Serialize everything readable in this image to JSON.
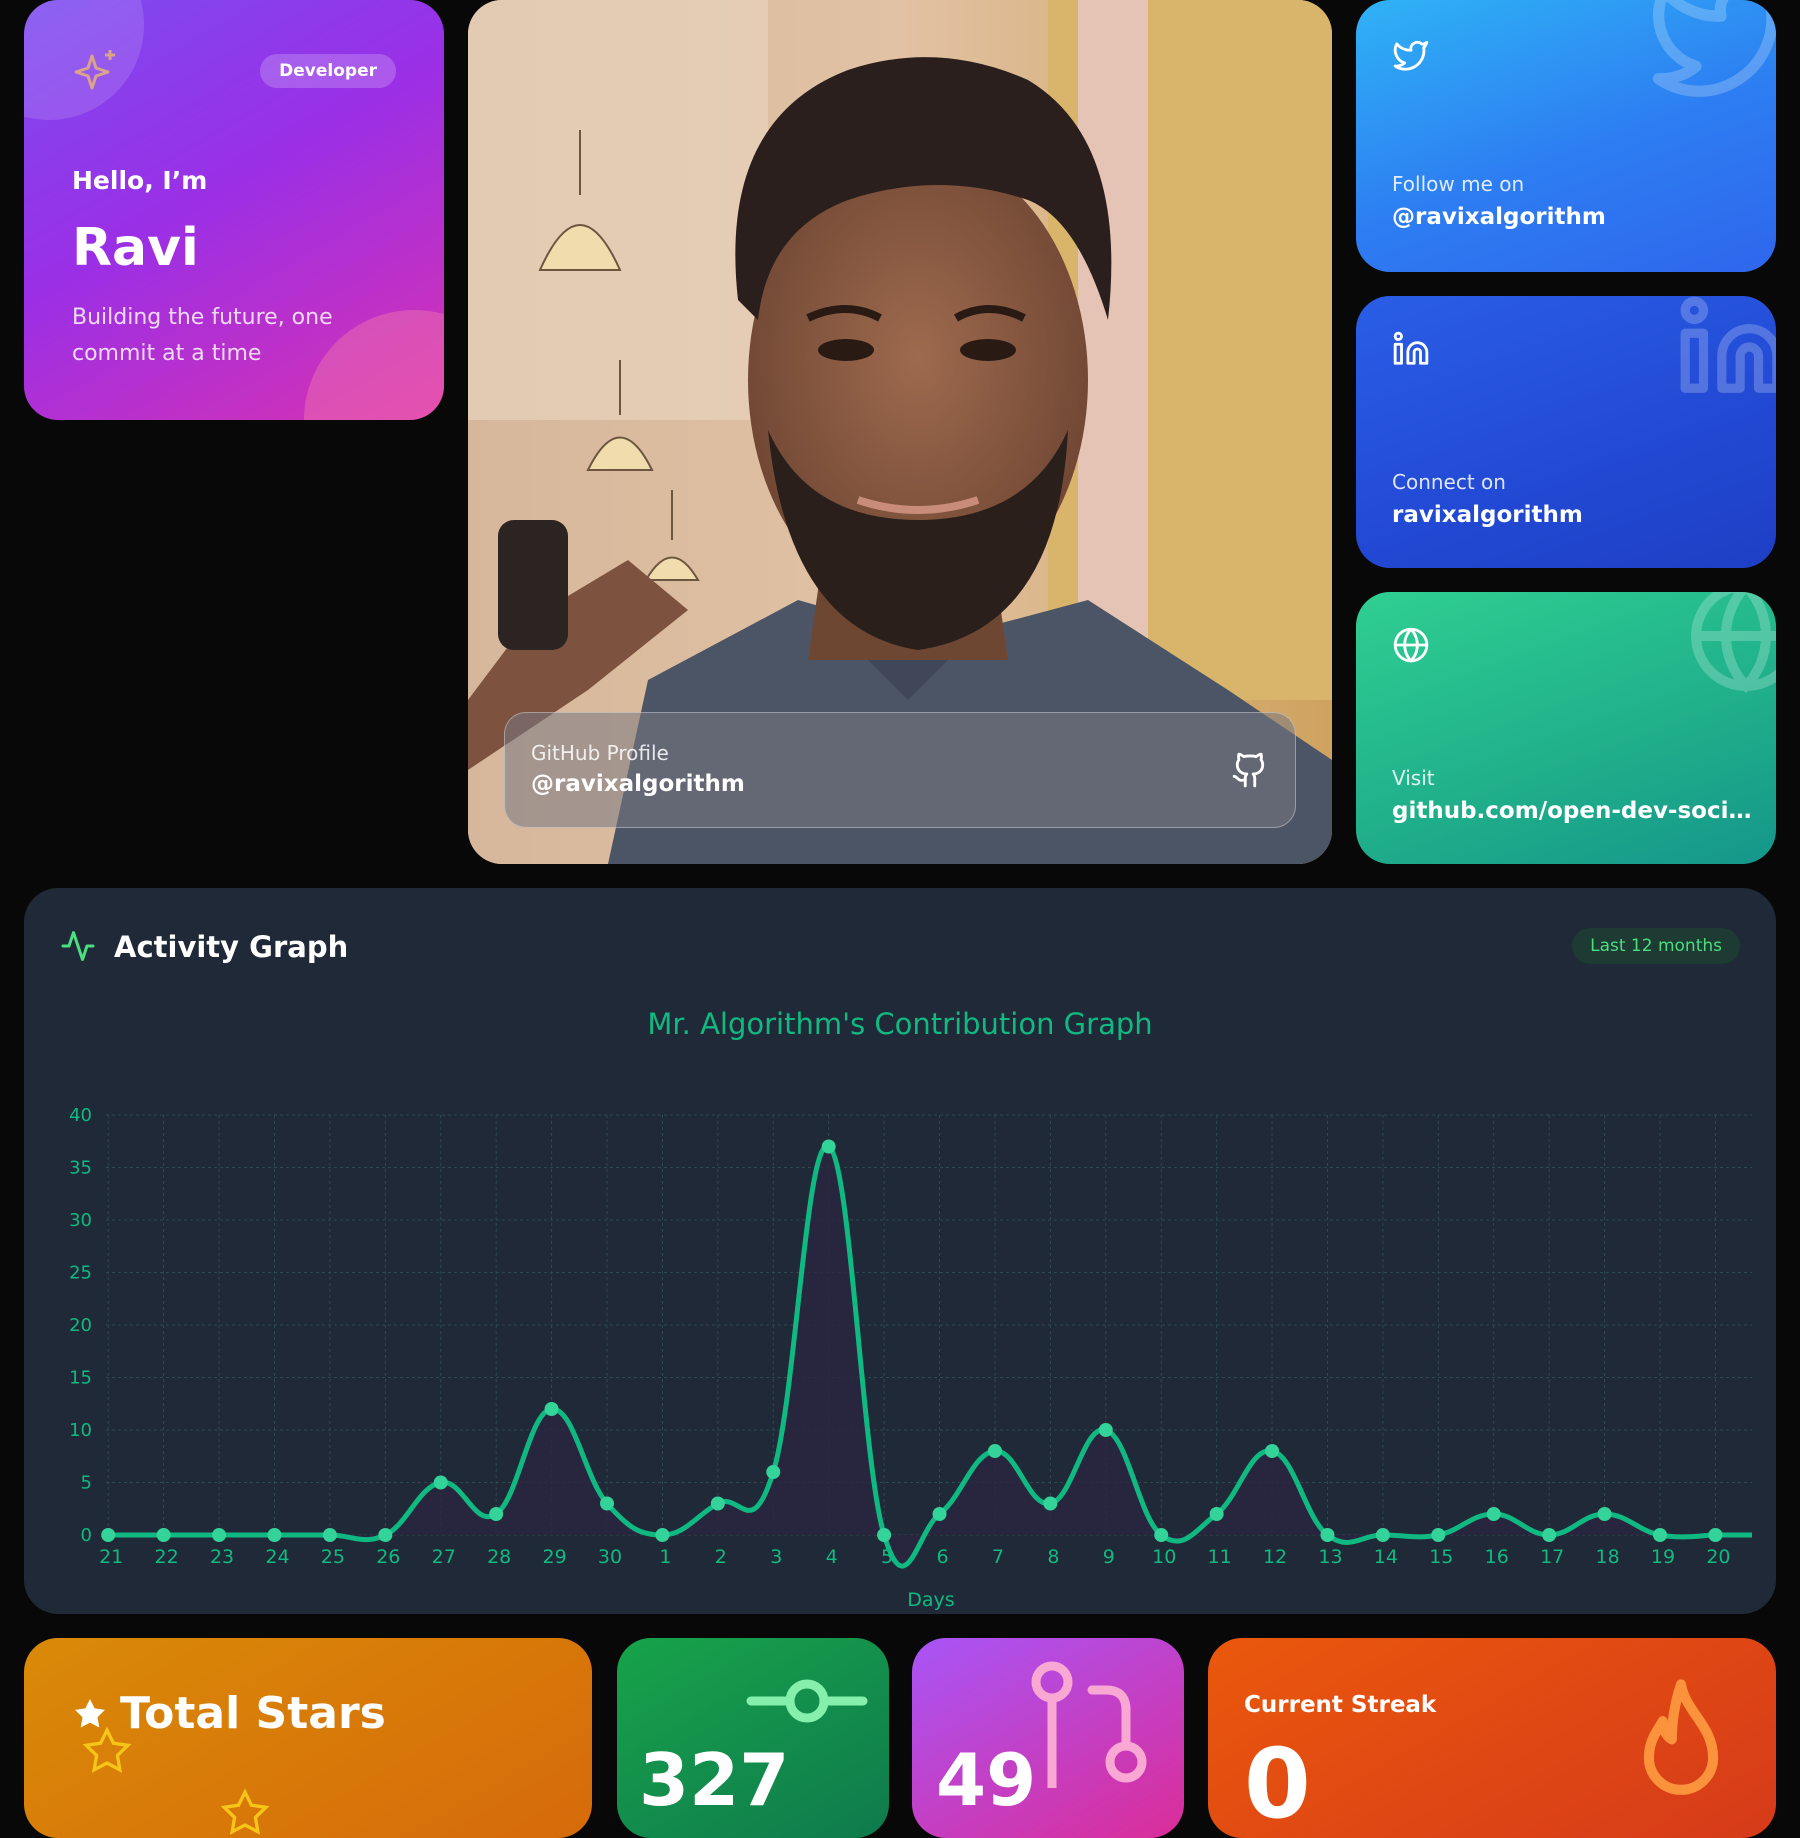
{
  "intro": {
    "badge": "Developer",
    "greeting": "Hello, I’m",
    "name": "Ravi",
    "tagline": "Building the future, one commit at a time",
    "icon": "sparkles-icon"
  },
  "photo": {
    "label": "GitHub Profile",
    "handle": "@ravixalgorithm",
    "icon": "github-icon"
  },
  "twitter": {
    "label": "Follow me on",
    "value": "@ravixalgorithm",
    "icon": "twitter-icon"
  },
  "linkedin": {
    "label": "Connect on",
    "value": "ravixalgorithm",
    "icon": "linkedin-icon"
  },
  "website": {
    "label": "Visit",
    "value": "github.com/open-dev-socie...",
    "icon": "globe-icon"
  },
  "activity": {
    "title": "Activity Graph",
    "range_badge": "Last 12 months",
    "icon": "activity-pulse-icon"
  },
  "chart_data": {
    "type": "area",
    "title": "Mr. Algorithm's Contribution Graph",
    "xlabel": "Days",
    "ylabel": "",
    "categories": [
      "21",
      "22",
      "23",
      "24",
      "25",
      "26",
      "27",
      "28",
      "29",
      "30",
      "1",
      "2",
      "3",
      "4",
      "5",
      "6",
      "7",
      "8",
      "9",
      "10",
      "11",
      "12",
      "13",
      "14",
      "15",
      "16",
      "17",
      "18",
      "19",
      "20"
    ],
    "series": [
      {
        "values": [
          0,
          0,
          0,
          0,
          0,
          0,
          5,
          2,
          12,
          3,
          0,
          3,
          6,
          37,
          0,
          2,
          8,
          3,
          10,
          0,
          2,
          8,
          0,
          0,
          0,
          2,
          0,
          2,
          0,
          0
        ]
      }
    ],
    "ylim": [
      0,
      40
    ],
    "yticks": [
      0,
      5,
      10,
      15,
      20,
      25,
      30,
      35,
      40
    ],
    "grid": true,
    "colors": {
      "line": "#10b981",
      "fill": "#2a2640",
      "text": "#10b981",
      "grid": "#2f4a4f"
    }
  },
  "stats": {
    "stars_title": "Total Stars",
    "commits_value": "327",
    "prs_value": "49",
    "streak_label": "Current Streak",
    "streak_value": "0"
  }
}
